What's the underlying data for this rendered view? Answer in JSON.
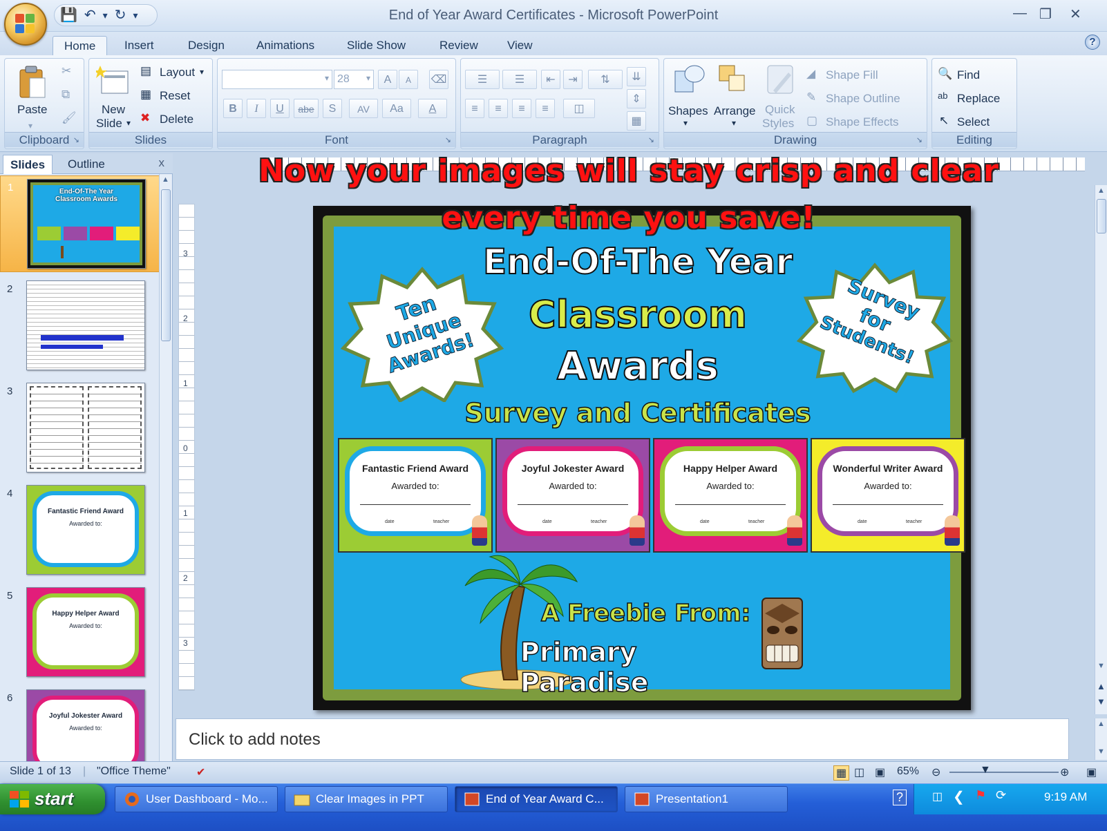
{
  "window": {
    "title": "End of Year Award Certificates - Microsoft PowerPoint"
  },
  "tabs": [
    "Home",
    "Insert",
    "Design",
    "Animations",
    "Slide Show",
    "Review",
    "View"
  ],
  "ribbon": {
    "clipboard": {
      "label": "Clipboard",
      "paste": "Paste"
    },
    "slides": {
      "label": "Slides",
      "new_slide": "New",
      "new_slide_2": "Slide",
      "layout": "Layout",
      "reset": "Reset",
      "delete": "Delete"
    },
    "font": {
      "label": "Font",
      "size": "28",
      "bold": "B",
      "italic": "I",
      "underline": "U",
      "strike": "abe",
      "shadow": "S",
      "spacing": "AV",
      "case": "Aa",
      "color": "A",
      "grow": "A",
      "shrink": "A"
    },
    "paragraph": {
      "label": "Paragraph"
    },
    "drawing": {
      "label": "Drawing",
      "shapes": "Shapes",
      "arrange": "Arrange",
      "quick": "Quick",
      "styles": "Styles",
      "fill": "Shape Fill",
      "outline": "Shape Outline",
      "effects": "Shape Effects"
    },
    "editing": {
      "label": "Editing",
      "find": "Find",
      "replace": "Replace",
      "select": "Select"
    }
  },
  "pane": {
    "slides_tab": "Slides",
    "outline_tab": "Outline",
    "close": "x",
    "thumbs": [
      "1",
      "2",
      "3",
      "4",
      "5",
      "6"
    ],
    "thumb1_title": "End-Of-The Year Classroom Awards",
    "thumb4_title": "Fantastic Friend Award",
    "thumb5_title": "Happy Helper Award",
    "thumb6_title": "Joyful Jokester Award",
    "thumb_awarded": "Awarded to:"
  },
  "overlay": {
    "line1": "Now your images will stay crisp and clear",
    "line2": "every time you save!"
  },
  "slide": {
    "title1": "End-Of-The Year",
    "title2": "Classroom",
    "title3": "Awards",
    "subtitle": "Survey and Certificates",
    "burst_left": [
      "Ten",
      "Unique",
      "Awards!"
    ],
    "burst_right": [
      "Survey",
      "for",
      "Students!"
    ],
    "certs": [
      {
        "title": "Fantastic Friend Award",
        "sub": "Awarded to:",
        "bg": "#9ccc34",
        "cloud": "#1ea9e6"
      },
      {
        "title": "Joyful Jokester Award",
        "sub": "Awarded to:",
        "bg": "#9b4aa6",
        "cloud": "#e21d7a"
      },
      {
        "title": "Happy Helper Award",
        "sub": "Awarded to:",
        "bg": "#e21d7a",
        "cloud": "#9ccc34"
      },
      {
        "title": "Wonderful Writer Award",
        "sub": "Awarded to:",
        "bg": "#f4ec2a",
        "cloud": "#9b4aa6"
      }
    ],
    "cert_date": "date",
    "cert_teacher": "teacher",
    "freebie1": "A Freebie From:",
    "freebie2": "Primary Paradise"
  },
  "ruler_v": [
    "3",
    "2",
    "1",
    "0",
    "1",
    "2",
    "3"
  ],
  "notes": {
    "placeholder": "Click to add notes"
  },
  "status": {
    "slide": "Slide 1 of 13",
    "theme": "\"Office Theme\"",
    "zoom": "65%"
  },
  "taskbar": {
    "start": "start",
    "items": [
      "User Dashboard - Mo...",
      "Clear Images in PPT",
      "End of Year Award C...",
      "Presentation1"
    ],
    "clock": "9:19 AM"
  }
}
